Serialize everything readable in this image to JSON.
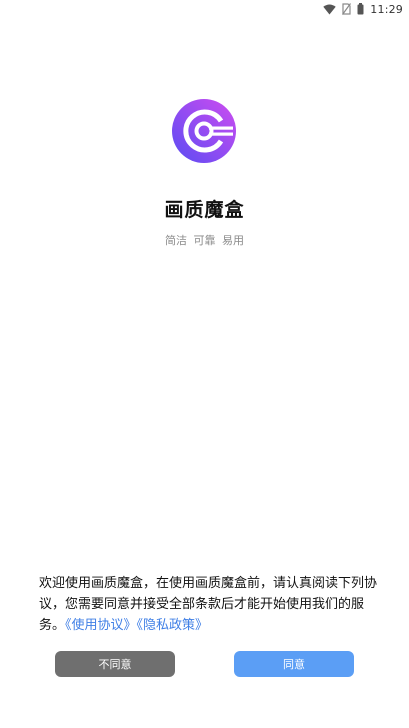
{
  "status_bar": {
    "time": "11:29",
    "icons": [
      "wifi-icon",
      "no-sim-icon",
      "battery-icon"
    ]
  },
  "app": {
    "name": "画质魔盒",
    "slogan": "简洁 可靠 易用",
    "logo_gradient": [
      "#6a4cf5",
      "#c94cf0"
    ]
  },
  "agreement": {
    "text": "欢迎使用画质魔盒，在使用画质魔盒前，请认真阅读下列协议，您需要同意并接受全部条款后才能开始使用我们的服务。",
    "links": [
      {
        "label": "《使用协议》"
      },
      {
        "label": "《隐私政策》"
      }
    ],
    "link_color": "#3f7fe6"
  },
  "buttons": {
    "disagree_label": "不同意",
    "agree_label": "同意",
    "disagree_color": "#6f6f6f",
    "agree_color": "#5b9ef5"
  }
}
